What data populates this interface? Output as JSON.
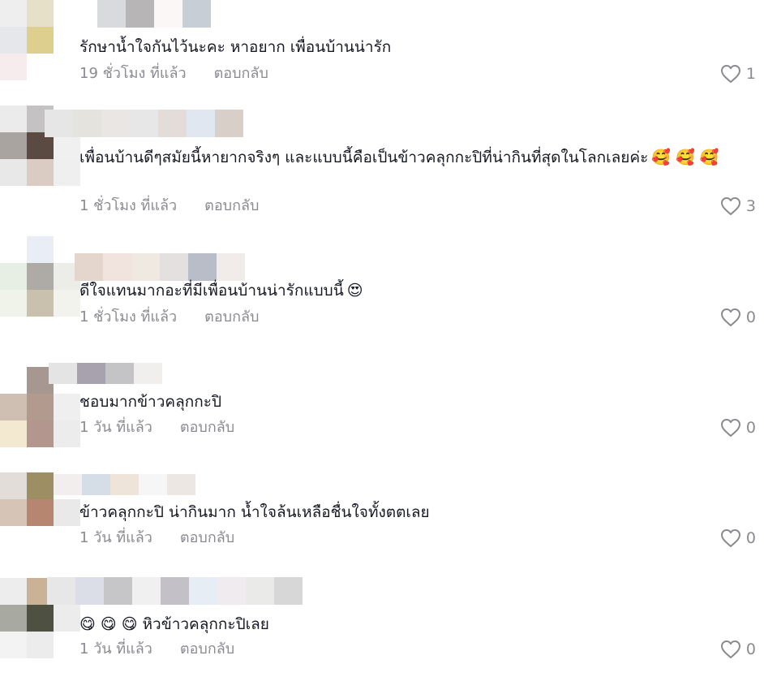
{
  "comments": [
    {
      "text": "รักษาน้ำใจกันไว้นะคะ หาอยาก เพื่อนบ้านน่ารัก",
      "emoji": "",
      "time": "19 ชั่วโมง ที่แล้ว",
      "reply": "ตอบกลับ",
      "likes": "1",
      "avatar_colors": [
        "#eeeeee",
        "#e5e0c7",
        "#ffffff",
        "#e6e7ea",
        "#ddd08f",
        "#ffffff",
        "#f6ecee",
        "#ffffff",
        "#ffffff"
      ],
      "name_colors": [
        "#d9dadd",
        "#b8b5b6",
        "#fbf7f6",
        "#c8ced6"
      ]
    },
    {
      "text": "เพื่อนบ้านดีๆสมัยนี้หายากจริงๆ และแบบนี้คือเป็นข้าวคลุกกะปิที่น่ากินที่สุดในโลกเลยค่ะ",
      "emoji": "🥰 🥰 🥰",
      "time": "1 ชั่วโมง ที่แล้ว",
      "reply": "ตอบกลับ",
      "likes": "3",
      "avatar_colors": [
        "#ebebeb",
        "#c4c2c2",
        "#ffffff",
        "#a9a49f",
        "#5a4a41",
        "#f0f0f0",
        "#e8e8e8",
        "#dacbc3",
        "#efefef"
      ],
      "name_colors": [
        "#e6e6e6",
        "#e5e3dd",
        "#e9e6e4",
        "#e7e7e7",
        "#e3dcd8",
        "#e1e7f0",
        "#d9cfc9"
      ]
    },
    {
      "text": "ดีใจแทนมากอะที่มีเพื่อนบ้านน่ารักแบบนี้",
      "emoji": "😍",
      "time": "1 ชั่วโมง ที่แล้ว",
      "reply": "ตอบกลับ",
      "likes": "0",
      "avatar_colors": [
        "#ffffff",
        "#e9eef6",
        "#ffffff",
        "#e7efe5",
        "#aeaaa6",
        "#ecede9",
        "#f0f3ea",
        "#c9c0ae",
        "#f3f3ee"
      ],
      "name_colors": [
        "#e5d6cd",
        "#f1e3dd",
        "#f0e9e2",
        "#e3e0df",
        "#b9bdc8",
        "#f1ebe9"
      ]
    },
    {
      "text": "ชอบมากข้าวคลุกกะปิ",
      "emoji": "",
      "time": "1 วัน ที่แล้ว",
      "reply": "ตอบกลับ",
      "likes": "0",
      "avatar_colors": [
        "#ffffff",
        "#a69790",
        "#ffffff",
        "#cfbfb2",
        "#b39a8f",
        "#efefef",
        "#f2e9d0",
        "#b3978f",
        "#ececec"
      ],
      "name_colors": [
        "#e4e4e4",
        "#a8a2ae",
        "#c4c3c5",
        "#f0efee"
      ]
    },
    {
      "text": "ข้าวคลุกกะปิ น่ากินมาก น้ำใจล้นเหลือชื่นใจทั้งตตเลย",
      "emoji": "",
      "time": "1 วัน ที่แล้ว",
      "reply": "ตอบกลับ",
      "likes": "0",
      "avatar_colors": [
        "#e2ddd8",
        "#9d8e64",
        "#ffffff",
        "#d6c5b6",
        "#b68671",
        "#e9e9e9",
        "#ffffff",
        "#ffffff",
        "#ffffff"
      ],
      "name_colors": [
        "#f3eeee",
        "#d5dde6",
        "#efe4da",
        "#f6f6f6",
        "#ede7e4"
      ]
    },
    {
      "text": "หิวข้าวคลุกกะปิเลย",
      "emoji": "😋 😋 😋",
      "time": "1 วัน ที่แล้ว",
      "reply": "ตอบกลับ",
      "likes": "0",
      "avatar_colors": [
        "#ededed",
        "#c9b296",
        "#ffffff",
        "#a8aaa2",
        "#4e5142",
        "#ececec",
        "#f3f3f3",
        "#ececec",
        "#ffffff"
      ],
      "name_colors": [
        "#e7e7e7",
        "#dbdde7",
        "#c6c6c8",
        "#f0f0f0",
        "#c4c0c8",
        "#e7edf4",
        "#f0ebee",
        "#eaeae8",
        "#d7d7d7"
      ]
    }
  ]
}
